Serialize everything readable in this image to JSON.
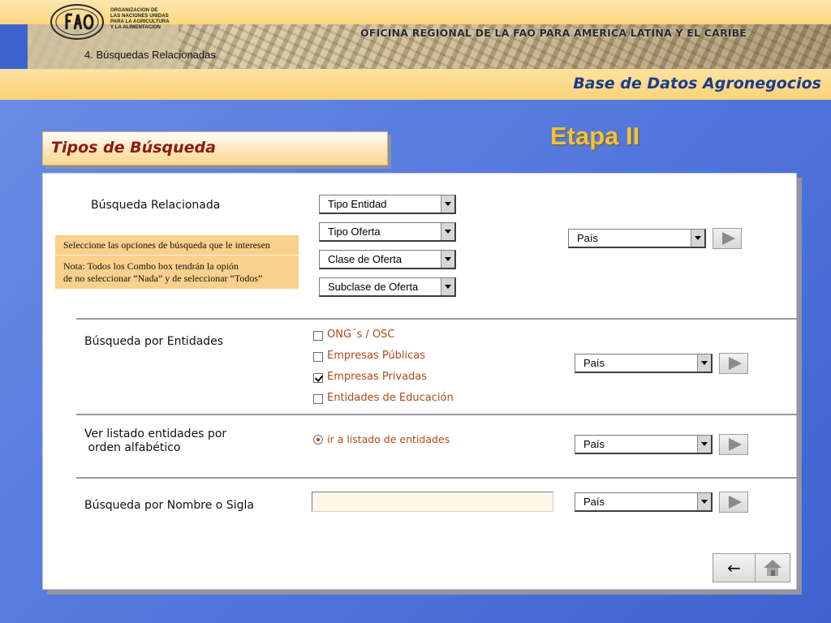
{
  "header": {
    "org_name_lines": [
      "ORGANIZACION DE",
      "LAS NACIONES UNIDAS",
      "PARA LA AGRICULTURA",
      "Y LA ALIMENTACION"
    ],
    "office_title": "OFICINA REGIONAL DE LA FAO PARA AMERICA LATINA Y EL CARIBE",
    "breadcrumb": "4. Búsquedas Relacionadas",
    "database_title": "Base de Datos Agronegocios",
    "stage_title": "Etapa II"
  },
  "section": {
    "tab_label": "Tipos de Búsqueda"
  },
  "related_search": {
    "label": "Búsqueda  Relacionada",
    "combos": [
      "Tipo Entidad",
      "Tipo Oferta",
      "Clase de Oferta",
      "Subclase de Oferta"
    ],
    "country_combo": "País",
    "note": {
      "line1": "Seleccione las opciones de búsqueda que le interesen",
      "line2": "Nota: Todos los Combo box tendrán la opión",
      "line3": "de no seleccionar “Nada” y de seleccionar “Todos”"
    }
  },
  "entity_search": {
    "label": "Búsqueda por Entidades",
    "options": [
      {
        "label": "ONG´s / OSC",
        "checked": false
      },
      {
        "label": "Empresas Públicas",
        "checked": false
      },
      {
        "label": "Empresas Privadas",
        "checked": true
      },
      {
        "label": "Entidades de Educación",
        "checked": false
      }
    ],
    "country_combo": "País"
  },
  "alphabetical_list": {
    "label_line1": "Ver listado entidades por",
    "label_line2": " orden alfabético",
    "radio_label": "ir a listado de entidades",
    "country_combo": "País"
  },
  "name_search": {
    "label": "Búsqueda por Nombre o Sigla",
    "input_value": "",
    "country_combo": "País"
  },
  "nav": {
    "back_glyph": "←"
  },
  "colors": {
    "accent_red": "#8a1b12",
    "option_orange": "#b04a16",
    "stage_gold": "#f3c238",
    "title_blue": "#1a3c8c"
  }
}
